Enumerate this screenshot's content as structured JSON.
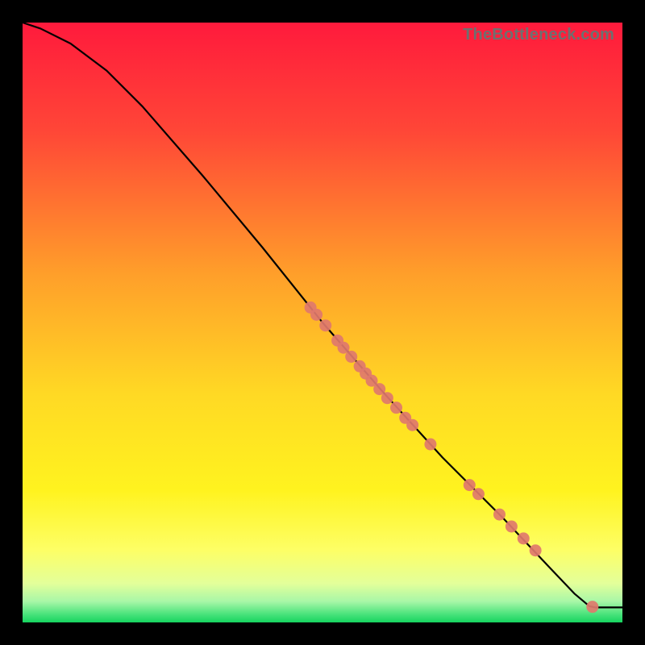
{
  "watermark": "TheBottleneck.com",
  "colors": {
    "frame_bg": "#000000",
    "curve": "#000000",
    "point_fill": "#e0786d",
    "point_stroke": "#c96357",
    "gradient_stops": [
      {
        "offset": 0.0,
        "color": "#ff1a3c"
      },
      {
        "offset": 0.18,
        "color": "#ff4637"
      },
      {
        "offset": 0.42,
        "color": "#ff9f2a"
      },
      {
        "offset": 0.62,
        "color": "#ffd924"
      },
      {
        "offset": 0.78,
        "color": "#fff31f"
      },
      {
        "offset": 0.88,
        "color": "#fdff66"
      },
      {
        "offset": 0.935,
        "color": "#e3ff9a"
      },
      {
        "offset": 0.965,
        "color": "#a8f7a7"
      },
      {
        "offset": 0.985,
        "color": "#4fe47e"
      },
      {
        "offset": 1.0,
        "color": "#16d45f"
      }
    ]
  },
  "chart_data": {
    "type": "line",
    "title": "",
    "xlabel": "",
    "ylabel": "",
    "xlim": [
      0,
      100
    ],
    "ylim": [
      0,
      100
    ],
    "curve": [
      {
        "x": 0,
        "y": 100
      },
      {
        "x": 3,
        "y": 99
      },
      {
        "x": 8,
        "y": 96.5
      },
      {
        "x": 14,
        "y": 92
      },
      {
        "x": 20,
        "y": 86
      },
      {
        "x": 30,
        "y": 74.5
      },
      {
        "x": 40,
        "y": 62.5
      },
      {
        "x": 50,
        "y": 50.0
      },
      {
        "x": 60,
        "y": 38.5
      },
      {
        "x": 70,
        "y": 27.5
      },
      {
        "x": 80,
        "y": 17.5
      },
      {
        "x": 88,
        "y": 9.0
      },
      {
        "x": 92,
        "y": 4.8
      },
      {
        "x": 94.5,
        "y": 2.7
      },
      {
        "x": 95.5,
        "y": 2.5
      },
      {
        "x": 100,
        "y": 2.5
      }
    ],
    "points": [
      {
        "x": 48.0,
        "y": 52.5
      },
      {
        "x": 49.0,
        "y": 51.3
      },
      {
        "x": 50.5,
        "y": 49.5
      },
      {
        "x": 52.5,
        "y": 47.0
      },
      {
        "x": 53.5,
        "y": 45.8
      },
      {
        "x": 54.8,
        "y": 44.3
      },
      {
        "x": 56.2,
        "y": 42.7
      },
      {
        "x": 57.2,
        "y": 41.5
      },
      {
        "x": 58.2,
        "y": 40.3
      },
      {
        "x": 59.5,
        "y": 38.9
      },
      {
        "x": 60.8,
        "y": 37.4
      },
      {
        "x": 62.3,
        "y": 35.8
      },
      {
        "x": 63.8,
        "y": 34.1
      },
      {
        "x": 65.0,
        "y": 32.9
      },
      {
        "x": 68.0,
        "y": 29.7
      },
      {
        "x": 74.5,
        "y": 22.9
      },
      {
        "x": 76.0,
        "y": 21.4
      },
      {
        "x": 79.5,
        "y": 18.0
      },
      {
        "x": 81.5,
        "y": 16.0
      },
      {
        "x": 83.5,
        "y": 14.0
      },
      {
        "x": 85.5,
        "y": 12.0
      },
      {
        "x": 95.0,
        "y": 2.6
      }
    ]
  }
}
